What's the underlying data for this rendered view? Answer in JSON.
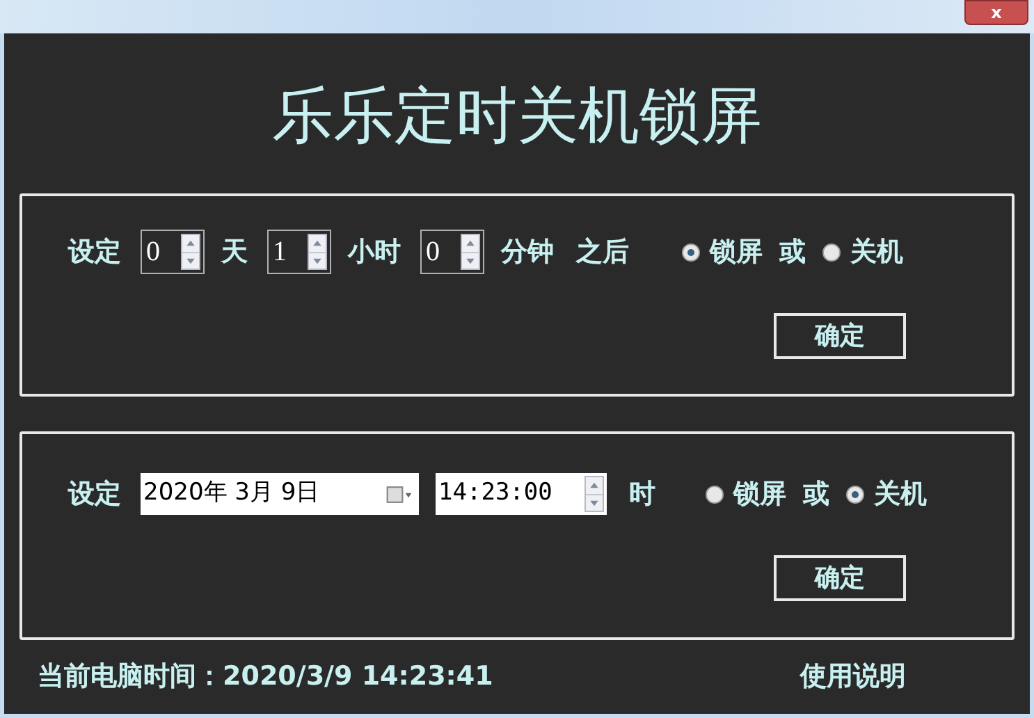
{
  "window": {
    "close_label": "x",
    "title": "乐乐定时关机锁屏"
  },
  "countdown": {
    "label": "设定",
    "spinners": [
      {
        "value": "0",
        "unit": "天"
      },
      {
        "value": "1",
        "unit": "小时"
      },
      {
        "value": "0",
        "unit": "分钟"
      }
    ],
    "suffix": "之后",
    "options": [
      {
        "label": "锁屏",
        "selected": true
      },
      {
        "label": "关机",
        "selected": false
      }
    ],
    "connector": "或",
    "button": "确定"
  },
  "schedule": {
    "label": "设定",
    "date": "2020年 3月 9日",
    "time": "14:23:00",
    "unit": "时",
    "options": [
      {
        "label": "锁屏",
        "selected": false
      },
      {
        "label": "关机",
        "selected": true
      }
    ],
    "connector": "或",
    "button": "确定"
  },
  "footer": {
    "clock": "当前电脑时间：2020/3/9 14:23:41",
    "help_link": "使用说明"
  }
}
